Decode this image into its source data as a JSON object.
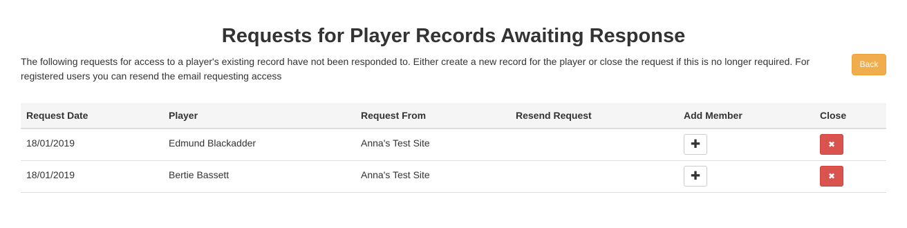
{
  "page": {
    "title": "Requests for Player Records Awaiting Response",
    "description": "The following requests for access to a player's existing record have not been responded to. Either create a new record for the player or close the request if this is no longer required. For registered users you can resend the email requesting access",
    "back_label": "Back"
  },
  "colors": {
    "back_button": "#f0ad4e",
    "close_button": "#d9534f",
    "header_background": "#f5f5f5"
  },
  "table": {
    "headers": {
      "request_date": "Request Date",
      "player": "Player",
      "request_from": "Request From",
      "resend_request": "Resend Request",
      "add_member": "Add Member",
      "close": "Close"
    },
    "rows": [
      {
        "request_date": "18/01/2019",
        "player": "Edmund Blackadder",
        "request_from": "Anna's Test Site",
        "resend_request": "",
        "add_member_icon": "plus-icon",
        "close_icon": "x-icon"
      },
      {
        "request_date": "18/01/2019",
        "player": "Bertie Bassett",
        "request_from": "Anna's Test Site",
        "resend_request": "",
        "add_member_icon": "plus-icon",
        "close_icon": "x-icon"
      }
    ]
  }
}
